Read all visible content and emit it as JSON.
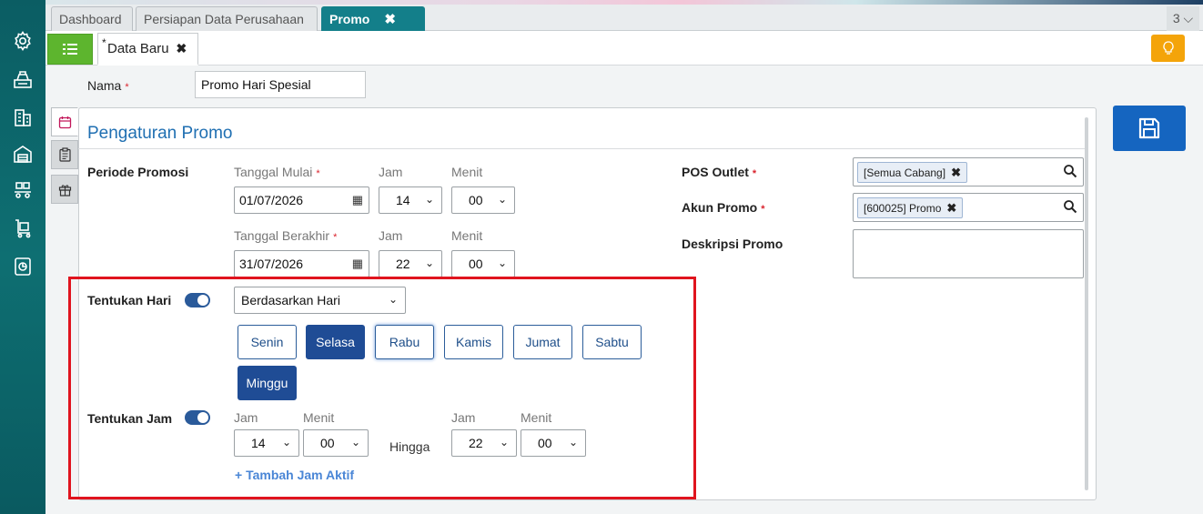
{
  "tabs": {
    "items": [
      {
        "label": "Dashboard"
      },
      {
        "label": "Persiapan Data Perusahaan"
      },
      {
        "label": "Promo"
      }
    ],
    "close_symbol": "✖",
    "count": "3 ⌵"
  },
  "doc_tab": {
    "star": "*",
    "label": "Data Baru",
    "close": "✖"
  },
  "form": {
    "nama_label": "Nama",
    "nama_value": "Promo Hari Spesial",
    "required_mark": "*"
  },
  "panel": {
    "title": "Pengaturan Promo",
    "periode_label": "Periode Promosi",
    "tanggal_mulai_label": "Tanggal Mulai",
    "tanggal_mulai_value": "01/07/2026",
    "jam_label": "Jam",
    "menit_label": "Menit",
    "jam_mulai_value": "14",
    "menit_mulai_value": "00",
    "tanggal_berakhir_label": "Tanggal Berakhir",
    "tanggal_berakhir_value": "31/07/2026",
    "jam_berakhir_value": "22",
    "menit_berakhir_value": "00",
    "tentukan_hari_label": "Tentukan Hari",
    "hari_mode_value": "Berdasarkan Hari",
    "days": [
      {
        "label": "Senin",
        "selected": false
      },
      {
        "label": "Selasa",
        "selected": true
      },
      {
        "label": "Rabu",
        "selected": false
      },
      {
        "label": "Kamis",
        "selected": false
      },
      {
        "label": "Jumat",
        "selected": false
      },
      {
        "label": "Sabtu",
        "selected": false
      },
      {
        "label": "Minggu",
        "selected": true
      }
    ],
    "tentukan_jam_label": "Tentukan Jam",
    "jam_from_value": "14",
    "menit_from_value": "00",
    "hingga_label": "Hingga",
    "jam_to_value": "22",
    "menit_to_value": "00",
    "tambah_jam_label": "+ Tambah Jam Aktif",
    "pos_outlet_label": "POS Outlet",
    "pos_outlet_tag": "[Semua Cabang]",
    "akun_promo_label": "Akun Promo",
    "akun_promo_tag": "[600025] Promo",
    "deskripsi_label": "Deskripsi Promo",
    "tag_close": "✖"
  },
  "colors": {
    "sidebar": "#0e6f72",
    "active_tab": "#137f8a",
    "accent_blue": "#1f4c95",
    "save_button": "#1565c0",
    "highlight_box": "#e0141e"
  }
}
